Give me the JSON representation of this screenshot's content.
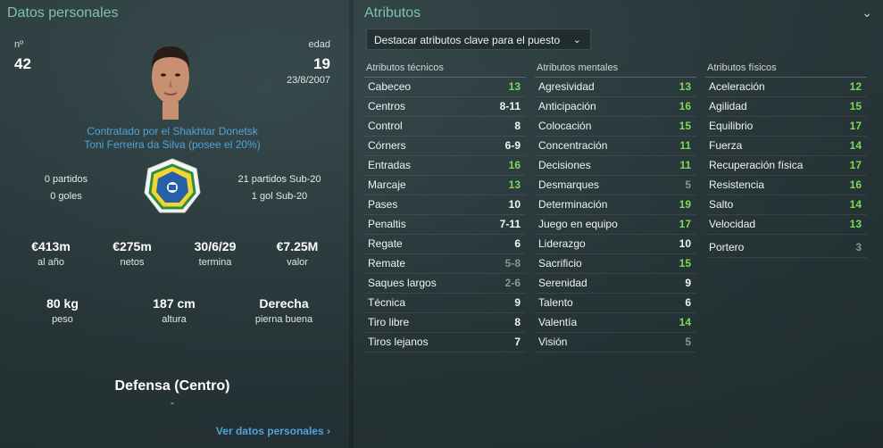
{
  "left": {
    "title": "Datos personales",
    "number_label": "nº",
    "number": "42",
    "age_label": "edad",
    "age": "19",
    "dob": "23/8/2007",
    "contract_line1": "Contratado por el Shakhtar Donetsk",
    "contract_line2": "Toni Ferreira da Silva (posee el 20%)",
    "caps": "0 partidos",
    "goals": "0 goles",
    "u20_caps": "21 partidos Sub-20",
    "u20_goals": "1 gol Sub-20",
    "stats": [
      {
        "value": "€413m",
        "label": "al año"
      },
      {
        "value": "€275m",
        "label": "netos"
      },
      {
        "value": "30/6/29",
        "label": "termina"
      },
      {
        "value": "€7.25M",
        "label": "valor"
      }
    ],
    "body": [
      {
        "value": "80 kg",
        "label": "peso"
      },
      {
        "value": "187 cm",
        "label": "altura"
      },
      {
        "value": "Derecha",
        "label": "pierna buena"
      }
    ],
    "position": "Defensa (Centro)",
    "position_sub": "-",
    "more_link": "Ver datos personales"
  },
  "right": {
    "title": "Atributos",
    "highlight_dropdown": "Destacar atributos clave para el puesto",
    "technical": {
      "header": "Atributos técnicos",
      "rows": [
        {
          "name": "Cabeceo",
          "value": "13",
          "color": "green"
        },
        {
          "name": "Centros",
          "value": "8-11",
          "color": "white"
        },
        {
          "name": "Control",
          "value": "8",
          "color": "white"
        },
        {
          "name": "Córners",
          "value": "6-9",
          "color": "white"
        },
        {
          "name": "Entradas",
          "value": "16",
          "color": "green"
        },
        {
          "name": "Marcaje",
          "value": "13",
          "color": "green"
        },
        {
          "name": "Pases",
          "value": "10",
          "color": "white"
        },
        {
          "name": "Penaltis",
          "value": "7-11",
          "color": "white"
        },
        {
          "name": "Regate",
          "value": "6",
          "color": "white"
        },
        {
          "name": "Remate",
          "value": "5-8",
          "color": "grey"
        },
        {
          "name": "Saques largos",
          "value": "2-6",
          "color": "grey"
        },
        {
          "name": "Técnica",
          "value": "9",
          "color": "white"
        },
        {
          "name": "Tiro libre",
          "value": "8",
          "color": "white"
        },
        {
          "name": "Tiros lejanos",
          "value": "7",
          "color": "white"
        }
      ]
    },
    "mental": {
      "header": "Atributos mentales",
      "rows": [
        {
          "name": "Agresividad",
          "value": "13",
          "color": "green"
        },
        {
          "name": "Anticipación",
          "value": "16",
          "color": "green"
        },
        {
          "name": "Colocación",
          "value": "15",
          "color": "green"
        },
        {
          "name": "Concentración",
          "value": "11",
          "color": "green"
        },
        {
          "name": "Decisiones",
          "value": "11",
          "color": "green"
        },
        {
          "name": "Desmarques",
          "value": "5",
          "color": "grey"
        },
        {
          "name": "Determinación",
          "value": "19",
          "color": "green"
        },
        {
          "name": "Juego en equipo",
          "value": "17",
          "color": "green"
        },
        {
          "name": "Liderazgo",
          "value": "10",
          "color": "white"
        },
        {
          "name": "Sacrificio",
          "value": "15",
          "color": "green"
        },
        {
          "name": "Serenidad",
          "value": "9",
          "color": "white"
        },
        {
          "name": "Talento",
          "value": "6",
          "color": "white"
        },
        {
          "name": "Valentía",
          "value": "14",
          "color": "green"
        },
        {
          "name": "Visión",
          "value": "5",
          "color": "grey"
        }
      ]
    },
    "physical": {
      "header": "Atributos físicos",
      "rows": [
        {
          "name": "Aceleración",
          "value": "12",
          "color": "green"
        },
        {
          "name": "Agilidad",
          "value": "15",
          "color": "green"
        },
        {
          "name": "Equilibrio",
          "value": "17",
          "color": "green"
        },
        {
          "name": "Fuerza",
          "value": "14",
          "color": "green"
        },
        {
          "name": "Recuperación física",
          "value": "17",
          "color": "green"
        },
        {
          "name": "Resistencia",
          "value": "16",
          "color": "green"
        },
        {
          "name": "Salto",
          "value": "14",
          "color": "green"
        },
        {
          "name": "Velocidad",
          "value": "13",
          "color": "green"
        }
      ],
      "extra": {
        "name": "Portero",
        "value": "3",
        "color": "grey"
      }
    }
  },
  "colors": {
    "title": "#7fc3a8",
    "link": "#4fa3d9",
    "green": "#7ed957",
    "grey": "#8a9496",
    "white": "#f2f6f6"
  }
}
